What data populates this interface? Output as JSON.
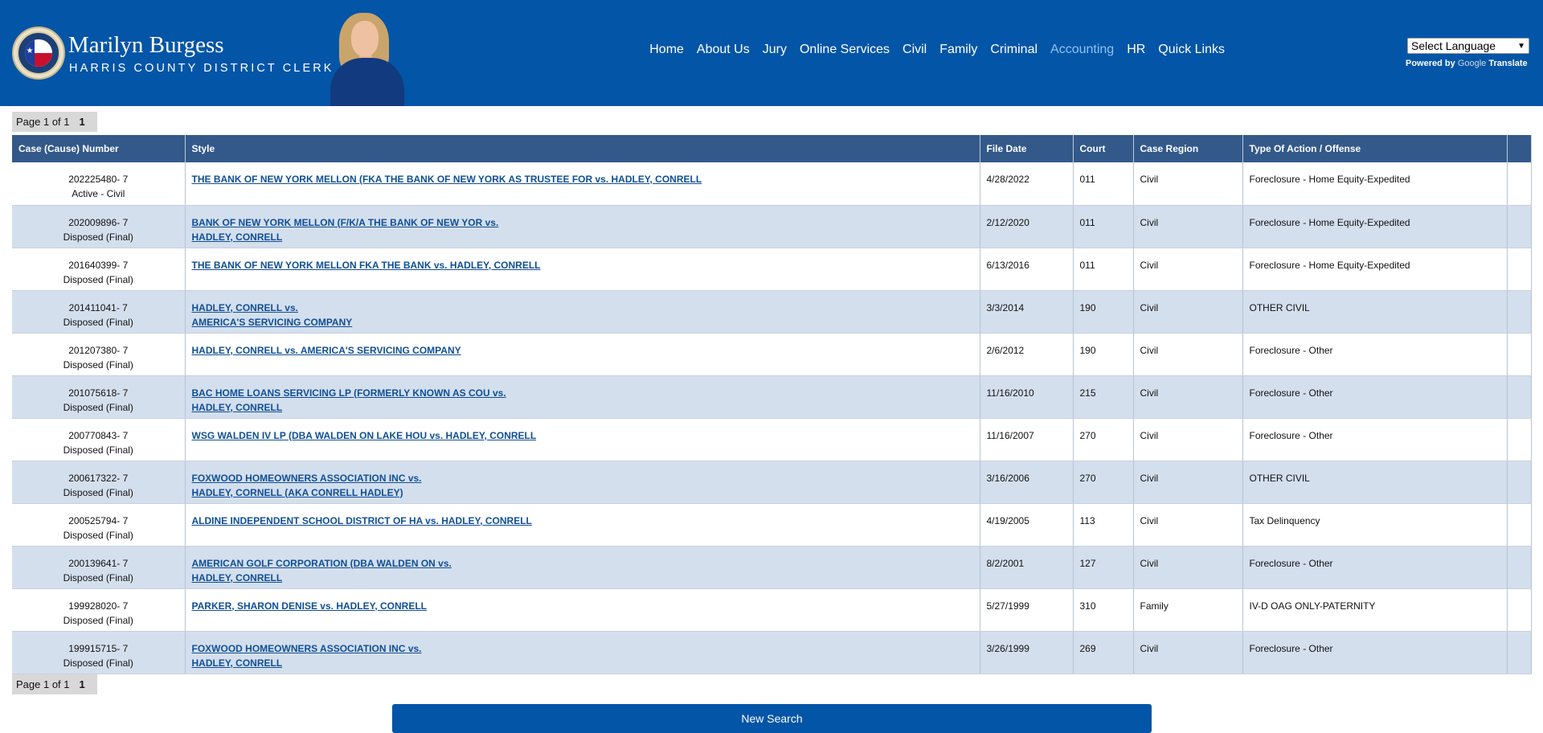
{
  "header": {
    "name": "Marilyn Burgess",
    "subtitle": "HARRIS COUNTY DISTRICT CLERK",
    "nav": [
      "Home",
      "About Us",
      "Jury",
      "Online Services",
      "Civil",
      "Family",
      "Criminal",
      "Accounting",
      "HR",
      "Quick Links"
    ],
    "active_nav": "Accounting",
    "language_select": "Select Language",
    "powered_by": "Powered by",
    "google": "Google",
    "translate": "Translate"
  },
  "pager": {
    "text": "Page 1 of 1",
    "page": "1"
  },
  "table": {
    "columns": [
      "Case (Cause) Number",
      "Style",
      "File Date",
      "Court",
      "Case Region",
      "Type Of Action / Offense"
    ],
    "rows": [
      {
        "case": "202225480- 7",
        "status": "Active - Civil",
        "style1": "THE BANK OF NEW YORK MELLON (FKA THE BANK OF NEW YORK AS TRUSTEE FOR vs. HADLEY, CONRELL",
        "style2": "",
        "date": "4/28/2022",
        "court": "011",
        "region": "Civil",
        "type": "Foreclosure - Home Equity-Expedited"
      },
      {
        "case": "202009896- 7",
        "status": "Disposed (Final)",
        "style1": "BANK OF NEW YORK MELLON (F/K/A THE BANK OF NEW YOR vs.",
        "style2": "HADLEY, CONRELL",
        "date": "2/12/2020",
        "court": "011",
        "region": "Civil",
        "type": "Foreclosure - Home Equity-Expedited"
      },
      {
        "case": "201640399- 7",
        "status": "Disposed (Final)",
        "style1": "THE BANK OF NEW YORK MELLON FKA THE BANK vs. HADLEY, CONRELL",
        "style2": "",
        "date": "6/13/2016",
        "court": "011",
        "region": "Civil",
        "type": "Foreclosure - Home Equity-Expedited"
      },
      {
        "case": "201411041- 7",
        "status": "Disposed (Final)",
        "style1": "HADLEY, CONRELL vs.",
        "style2": "AMERICA'S SERVICING COMPANY",
        "date": "3/3/2014",
        "court": "190",
        "region": "Civil",
        "type": "OTHER CIVIL"
      },
      {
        "case": "201207380- 7",
        "status": "Disposed (Final)",
        "style1": "HADLEY, CONRELL vs. AMERICA'S SERVICING COMPANY",
        "style2": "",
        "date": "2/6/2012",
        "court": "190",
        "region": "Civil",
        "type": "Foreclosure - Other"
      },
      {
        "case": "201075618- 7",
        "status": "Disposed (Final)",
        "style1": "BAC HOME LOANS SERVICING LP (FORMERLY KNOWN AS COU vs.",
        "style2": "HADLEY, CONRELL",
        "date": "11/16/2010",
        "court": "215",
        "region": "Civil",
        "type": "Foreclosure - Other"
      },
      {
        "case": "200770843- 7",
        "status": "Disposed (Final)",
        "style1": "WSG WALDEN IV LP (DBA WALDEN ON LAKE HOU vs. HADLEY, CONRELL",
        "style2": "",
        "date": "11/16/2007",
        "court": "270",
        "region": "Civil",
        "type": "Foreclosure - Other"
      },
      {
        "case": "200617322- 7",
        "status": "Disposed (Final)",
        "style1": "FOXWOOD HOMEOWNERS ASSOCIATION INC vs.",
        "style2": "HADLEY, CORNELL (AKA CONRELL HADLEY)",
        "date": "3/16/2006",
        "court": "270",
        "region": "Civil",
        "type": "OTHER CIVIL"
      },
      {
        "case": "200525794- 7",
        "status": "Disposed (Final)",
        "style1": "ALDINE INDEPENDENT SCHOOL DISTRICT OF HA vs. HADLEY, CONRELL",
        "style2": "",
        "date": "4/19/2005",
        "court": "113",
        "region": "Civil",
        "type": "Tax Delinquency"
      },
      {
        "case": "200139641- 7",
        "status": "Disposed (Final)",
        "style1": "AMERICAN GOLF CORPORATION (DBA WALDEN ON vs.",
        "style2": "HADLEY, CONRELL",
        "date": "8/2/2001",
        "court": "127",
        "region": "Civil",
        "type": "Foreclosure - Other"
      },
      {
        "case": "199928020- 7",
        "status": "Disposed (Final)",
        "style1": "PARKER, SHARON DENISE  vs. HADLEY, CONRELL",
        "style2": "",
        "date": "5/27/1999",
        "court": "310",
        "region": "Family",
        "type": "IV-D OAG ONLY-PATERNITY"
      },
      {
        "case": "199915715- 7",
        "status": "Disposed (Final)",
        "style1": "FOXWOOD HOMEOWNERS ASSOCIATION INC  vs.",
        "style2": "HADLEY, CONRELL",
        "date": "3/26/1999",
        "court": "269",
        "region": "Civil",
        "type": "Foreclosure - Other"
      }
    ]
  },
  "new_search": "New Search",
  "colors": {
    "header_bg": "#0355a7",
    "table_header_bg": "#33598b",
    "row_alt_bg": "#d4dfee",
    "link": "#104f95",
    "active_nav": "#8fc2f2"
  }
}
